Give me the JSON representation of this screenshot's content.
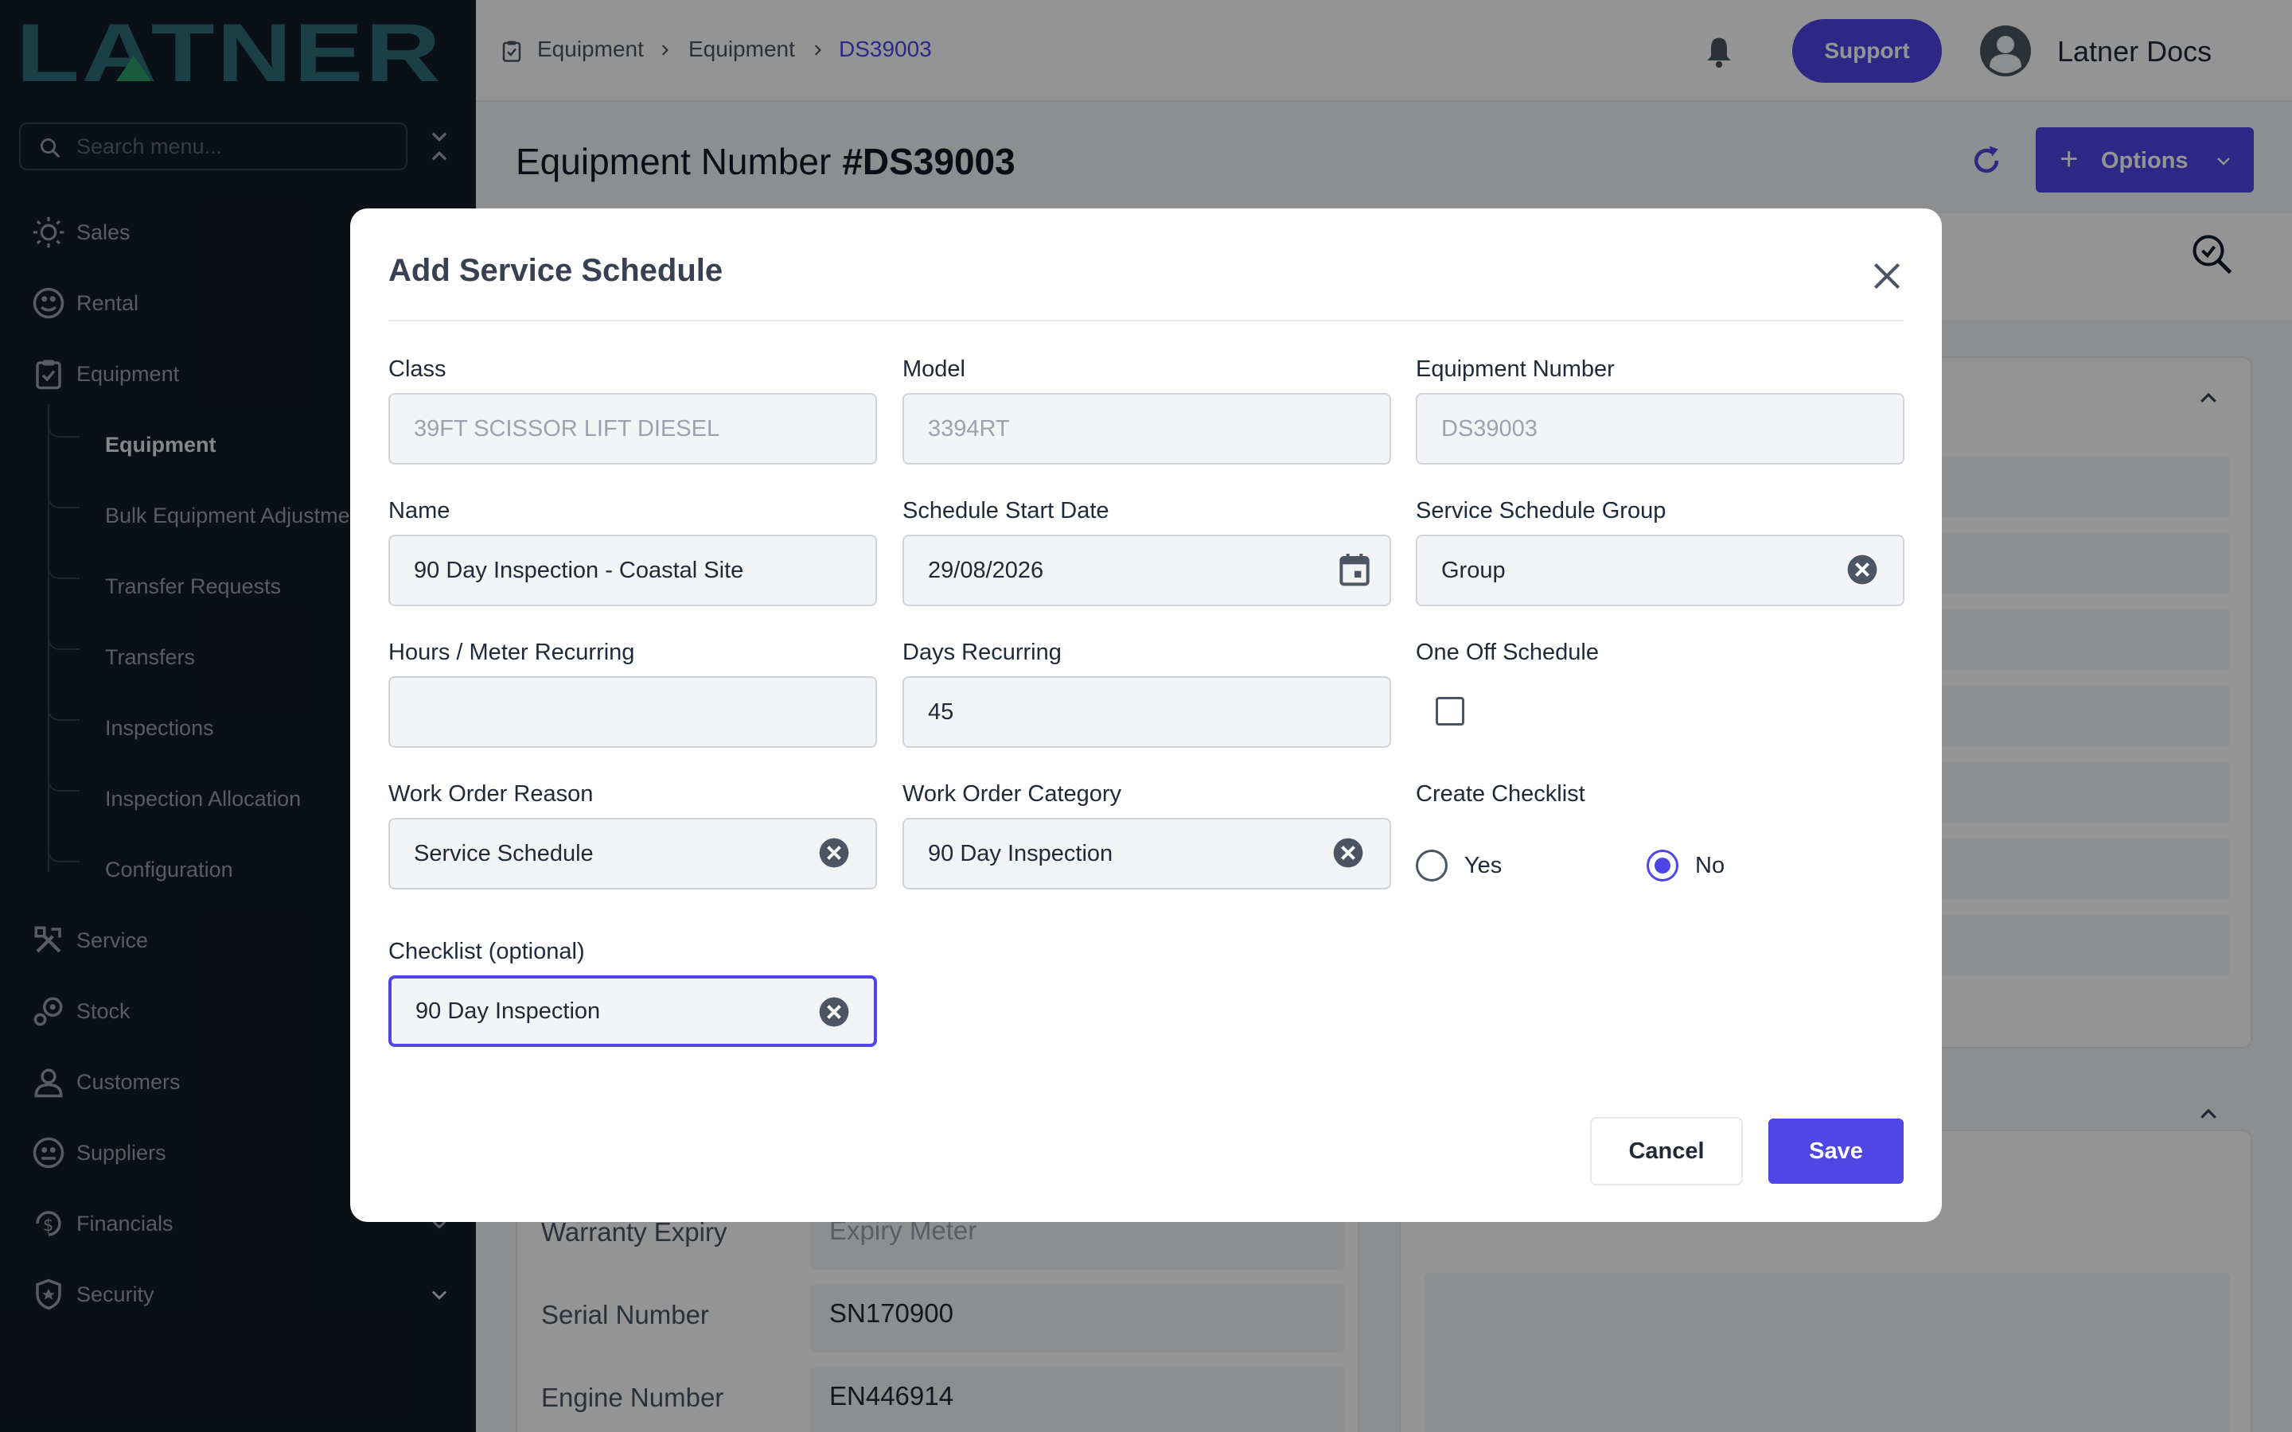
{
  "brand": {
    "logo_text": "LATNER"
  },
  "sidebar": {
    "search_placeholder": "Search menu...",
    "items": [
      {
        "label": "Sales",
        "icon": "sales-icon"
      },
      {
        "label": "Rental",
        "icon": "rental-icon"
      },
      {
        "label": "Equipment",
        "icon": "clipboard-icon",
        "expanded": true
      },
      {
        "label": "Service",
        "icon": "tools-icon"
      },
      {
        "label": "Stock",
        "icon": "stock-icon"
      },
      {
        "label": "Customers",
        "icon": "person-icon"
      },
      {
        "label": "Suppliers",
        "icon": "supplier-icon"
      },
      {
        "label": "Financials",
        "icon": "dollar-icon"
      },
      {
        "label": "Security",
        "icon": "shield-icon"
      }
    ],
    "equipment_sub": [
      {
        "label": "Equipment",
        "active": true
      },
      {
        "label": "Bulk Equipment Adjustments"
      },
      {
        "label": "Transfer Requests"
      },
      {
        "label": "Transfers"
      },
      {
        "label": "Inspections"
      },
      {
        "label": "Inspection Allocation"
      },
      {
        "label": "Configuration"
      }
    ]
  },
  "header": {
    "breadcrumb": [
      "Equipment",
      "Equipment",
      "DS39003"
    ],
    "support_label": "Support",
    "user_name": "Latner Docs"
  },
  "page": {
    "title_prefix": "Equipment Number",
    "title_number": "#DS39003",
    "options_label": "Options",
    "fields": [
      {
        "label": "Warranty Expiry",
        "value": "Expiry Meter",
        "placeholder": true
      },
      {
        "label": "Serial Number",
        "value": "SN170900"
      },
      {
        "label": "Engine Number",
        "value": "EN446914"
      }
    ]
  },
  "modal": {
    "title": "Add Service Schedule",
    "class_label": "Class",
    "class_value": "39FT SCISSOR LIFT DIESEL",
    "model_label": "Model",
    "model_value": "3394RT",
    "equipment_number_label": "Equipment Number",
    "equipment_number_value": "DS39003",
    "name_label": "Name",
    "name_value": "90 Day Inspection - Coastal Site",
    "start_date_label": "Schedule Start Date",
    "start_date_value": "29/08/2026",
    "group_label": "Service Schedule Group",
    "group_value": "Group",
    "hours_label": "Hours / Meter Recurring",
    "hours_value": "",
    "days_label": "Days Recurring",
    "days_value": "45",
    "one_off_label": "One Off Schedule",
    "one_off_checked": false,
    "wo_reason_label": "Work Order Reason",
    "wo_reason_value": "Service Schedule",
    "wo_category_label": "Work Order Category",
    "wo_category_value": "90 Day Inspection",
    "create_checklist_label": "Create Checklist",
    "radio_yes": "Yes",
    "radio_no": "No",
    "create_checklist_selected": "No",
    "checklist_label": "Checklist (optional)",
    "checklist_value": "90 Day Inspection",
    "cancel_label": "Cancel",
    "save_label": "Save"
  },
  "colors": {
    "accent": "#4f46e5",
    "sidebar_bg": "#141b26",
    "logo": "#2f6d79",
    "logo_green": "#2e9e6a"
  }
}
